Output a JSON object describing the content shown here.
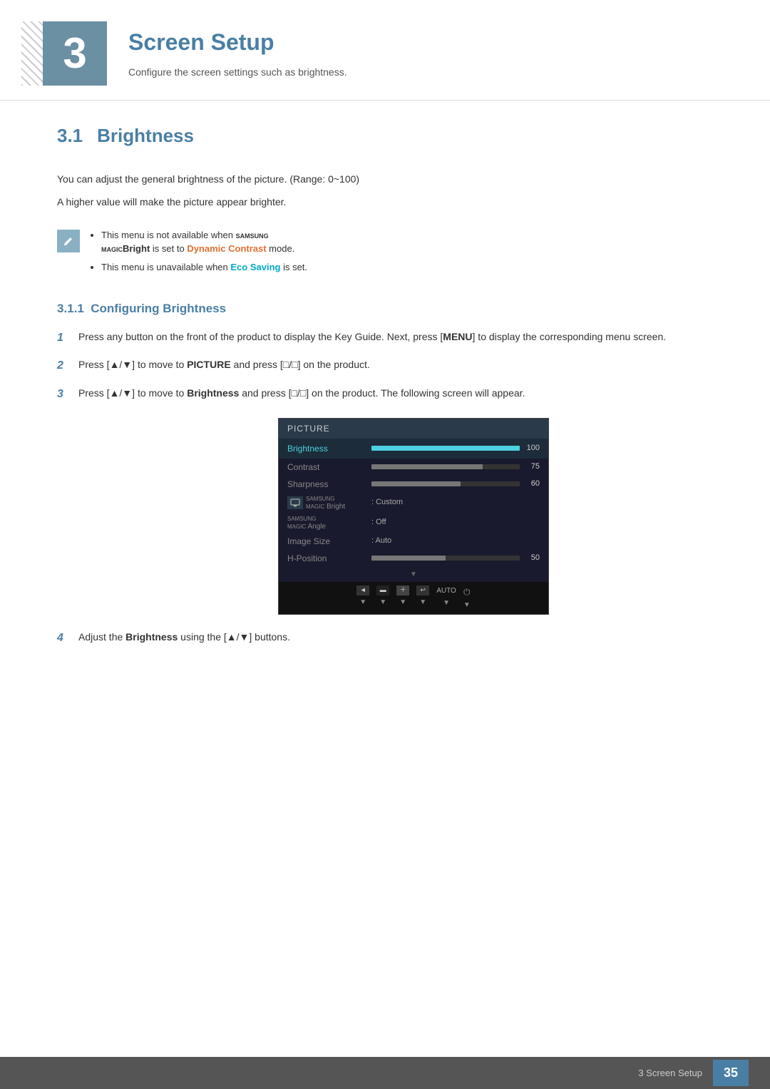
{
  "header": {
    "chapter_num": "3",
    "chapter_title": "Screen Setup",
    "chapter_subtitle": "Configure the screen settings such as brightness."
  },
  "section_31": {
    "number": "3.1",
    "title": "Brightness",
    "desc1": "You can adjust the general brightness of the picture. (Range: 0~100)",
    "desc2": "A higher value will make the picture appear brighter.",
    "notes": [
      "This menu is not available when SAMSUNGBright is set to Dynamic Contrast mode.",
      "This menu is unavailable when Eco Saving is set."
    ]
  },
  "subsection_311": {
    "number": "3.1.1",
    "title": "Configuring Brightness",
    "steps": [
      "Press any button on the front of the product to display the Key Guide. Next, press [MENU] to display the corresponding menu screen.",
      "Press [▲/▼] to move to PICTURE and press [□/□] on the product.",
      "Press [▲/▼] to move to Brightness and press [□/□] on the product. The following screen will appear.",
      "Adjust the Brightness using the [▲/▼] buttons."
    ]
  },
  "picture_menu": {
    "header": "PICTURE",
    "items": [
      {
        "label": "Brightness",
        "type": "bar",
        "fill_pct": 100,
        "value": "100",
        "active": true
      },
      {
        "label": "Contrast",
        "type": "bar",
        "fill_pct": 75,
        "value": "75",
        "active": false
      },
      {
        "label": "Sharpness",
        "type": "bar",
        "fill_pct": 60,
        "value": "60",
        "active": false
      },
      {
        "label": "SAMSUNG MAGIC Bright",
        "type": "text",
        "value": "Custom",
        "active": false
      },
      {
        "label": "SAMSUNG MAGIC Angle",
        "type": "text",
        "value": "Off",
        "active": false
      },
      {
        "label": "Image Size",
        "type": "text",
        "value": "Auto",
        "active": false
      },
      {
        "label": "H-Position",
        "type": "bar",
        "fill_pct": 50,
        "value": "50",
        "active": false
      }
    ]
  },
  "footer": {
    "section_label": "3 Screen Setup",
    "page_number": "35"
  }
}
